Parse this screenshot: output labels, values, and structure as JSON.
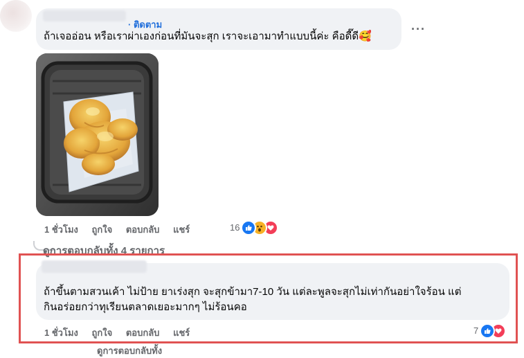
{
  "comment1": {
    "follow_label": "· ติดตาม",
    "text": "ถ้าเจออ่อน หรือเราผ่าเองก่อนที่มันจะสุก เราจะเอามาทำแบบนี้ค่ะ คือดี๊ดี",
    "emoji": "🥰",
    "more_label": "···",
    "time": "1 ชั่วโมง",
    "like_label": "ถูกใจ",
    "reply_label": "ตอบกลับ",
    "share_label": "แชร์",
    "reaction_count": "16",
    "reactions": [
      "like-icon",
      "wow-icon",
      "love-icon"
    ]
  },
  "view_replies": {
    "label": "ดูการตอบกลับทั้ง 4 รายการ"
  },
  "comment2": {
    "text_line1": "ถ้าขึ้นตามสวนเค้า ไม่ป้าย ยาเร่งสุก จะสุกข้ามา7-10 วัน แต่ละพูลจะสุกไม่เท่ากันอย่าใจร้อน แต่",
    "text_line2": "กินอร่อยกว่าทุเรียนตลาดเยอะมากๆ ไม่ร้อนคอ",
    "time": "1 ชั่วโมง",
    "like_label": "ถูกใจ",
    "reply_label": "ตอบกลับ",
    "share_label": "แชร์",
    "reaction_count": "7",
    "reactions": [
      "like-icon",
      "love-icon"
    ]
  },
  "bottom_partial": {
    "label": "ดูการตอบกลับทั้ง"
  },
  "colors": {
    "accent": "#216fdb",
    "highlight_border": "#e05252",
    "bubble_bg": "#f0f2f5",
    "like_blue": "#1877f2",
    "love_red": "#f33e58",
    "wow_yellow": "#f7b125"
  }
}
